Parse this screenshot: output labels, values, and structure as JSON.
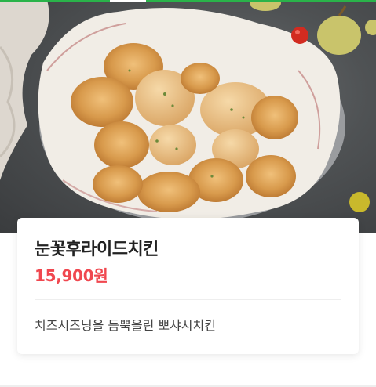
{
  "progress": {
    "segments_done": 2,
    "segments_total": 3,
    "accent": "#2ab34a"
  },
  "product": {
    "image_alt": "눈꽃후라이드치킨",
    "name": "눈꽃후라이드치킨",
    "price": "15,900원",
    "description": "치즈시즈닝을 듬뿍올린 뽀샤시치킨",
    "price_color": "#f0474f"
  }
}
